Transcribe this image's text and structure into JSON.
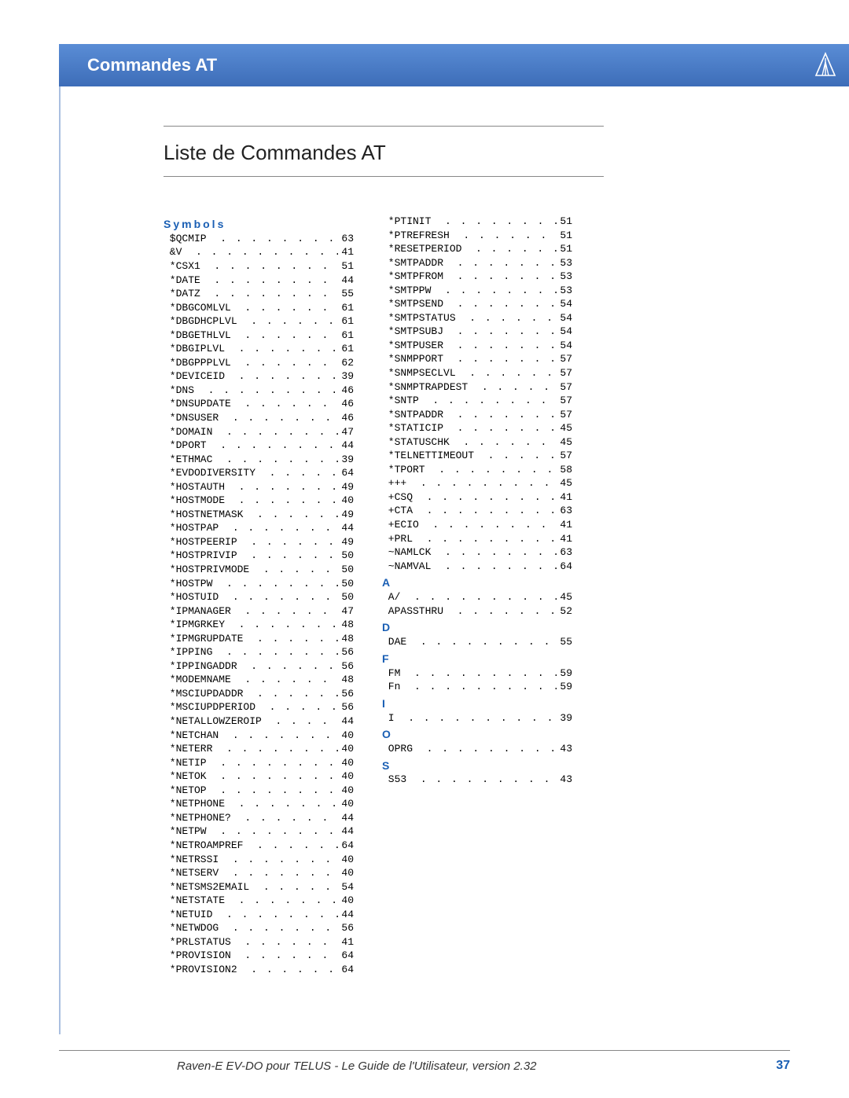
{
  "header": {
    "title": "Commandes AT"
  },
  "section": {
    "title": "Liste de Commandes AT"
  },
  "headings": {
    "symbols": "Symbols",
    "A": "A",
    "D": "D",
    "F": "F",
    "I": "I",
    "O": "O",
    "S": "S"
  },
  "col1": [
    {
      "cmd": "$QCMIP",
      "page": "63"
    },
    {
      "cmd": "&V",
      "page": "41"
    },
    {
      "cmd": "*CSX1",
      "page": "51"
    },
    {
      "cmd": "*DATE",
      "page": "44"
    },
    {
      "cmd": "*DATZ",
      "page": "55"
    },
    {
      "cmd": "*DBGCOMLVL",
      "page": "61"
    },
    {
      "cmd": "*DBGDHCPLVL",
      "page": "61"
    },
    {
      "cmd": "*DBGETHLVL",
      "page": "61"
    },
    {
      "cmd": "*DBGIPLVL",
      "page": "61"
    },
    {
      "cmd": "*DBGPPPLVL",
      "page": "62"
    },
    {
      "cmd": "*DEVICEID",
      "page": "39"
    },
    {
      "cmd": "*DNS",
      "page": "46"
    },
    {
      "cmd": "*DNSUPDATE",
      "page": "46"
    },
    {
      "cmd": "*DNSUSER",
      "page": "46"
    },
    {
      "cmd": "*DOMAIN",
      "page": "47"
    },
    {
      "cmd": "*DPORT",
      "page": "44"
    },
    {
      "cmd": "*ETHMAC",
      "page": "39"
    },
    {
      "cmd": "*EVDODIVERSITY",
      "page": "64"
    },
    {
      "cmd": "*HOSTAUTH",
      "page": "49"
    },
    {
      "cmd": "*HOSTMODE",
      "page": "40"
    },
    {
      "cmd": "*HOSTNETMASK",
      "page": "49"
    },
    {
      "cmd": "*HOSTPAP",
      "page": "44"
    },
    {
      "cmd": "*HOSTPEERIP",
      "page": "49"
    },
    {
      "cmd": "*HOSTPRIVIP",
      "page": "50"
    },
    {
      "cmd": "*HOSTPRIVMODE",
      "page": "50"
    },
    {
      "cmd": "*HOSTPW",
      "page": "50"
    },
    {
      "cmd": "*HOSTUID",
      "page": "50"
    },
    {
      "cmd": "*IPMANAGER",
      "page": "47"
    },
    {
      "cmd": "*IPMGRKEY",
      "page": "48"
    },
    {
      "cmd": "*IPMGRUPDATE",
      "page": "48"
    },
    {
      "cmd": "*IPPING",
      "page": "56"
    },
    {
      "cmd": "*IPPINGADDR",
      "page": "56"
    },
    {
      "cmd": "*MODEMNAME",
      "page": "48"
    },
    {
      "cmd": "*MSCIUPDADDR",
      "page": "56"
    },
    {
      "cmd": "*MSCIUPDPERIOD",
      "page": "56"
    },
    {
      "cmd": "*NETALLOWZEROIP",
      "page": "44"
    },
    {
      "cmd": "*NETCHAN",
      "page": "40"
    },
    {
      "cmd": "*NETERR",
      "page": "40"
    },
    {
      "cmd": "*NETIP",
      "page": "40"
    },
    {
      "cmd": "*NETOK",
      "page": "40"
    },
    {
      "cmd": "*NETOP",
      "page": "40"
    },
    {
      "cmd": "*NETPHONE",
      "page": "40"
    },
    {
      "cmd": "*NETPHONE?",
      "page": "44"
    },
    {
      "cmd": "*NETPW",
      "page": "44"
    },
    {
      "cmd": "*NETROAMPREF",
      "page": "64"
    },
    {
      "cmd": "*NETRSSI",
      "page": "40"
    },
    {
      "cmd": "*NETSERV",
      "page": "40"
    },
    {
      "cmd": "*NETSMS2EMAIL",
      "page": "54"
    },
    {
      "cmd": "*NETSTATE",
      "page": "40"
    },
    {
      "cmd": "*NETUID",
      "page": "44"
    },
    {
      "cmd": "*NETWDOG",
      "page": "56"
    },
    {
      "cmd": "*PRLSTATUS",
      "page": "41"
    },
    {
      "cmd": "*PROVISION",
      "page": "64"
    },
    {
      "cmd": "*PROVISION2",
      "page": "64"
    }
  ],
  "col2a": [
    {
      "cmd": "*PTINIT",
      "page": "51"
    },
    {
      "cmd": "*PTREFRESH",
      "page": "51"
    },
    {
      "cmd": "*RESETPERIOD",
      "page": "51"
    },
    {
      "cmd": "*SMTPADDR",
      "page": "53"
    },
    {
      "cmd": "*SMTPFROM",
      "page": "53"
    },
    {
      "cmd": "*SMTPPW",
      "page": "53"
    },
    {
      "cmd": "*SMTPSEND",
      "page": "54"
    },
    {
      "cmd": "*SMTPSTATUS",
      "page": "54"
    },
    {
      "cmd": "*SMTPSUBJ",
      "page": "54"
    },
    {
      "cmd": "*SMTPUSER",
      "page": "54"
    },
    {
      "cmd": "*SNMPPORT",
      "page": "57"
    },
    {
      "cmd": "*SNMPSECLVL",
      "page": "57"
    },
    {
      "cmd": "*SNMPTRAPDEST",
      "page": "57"
    },
    {
      "cmd": "*SNTP",
      "page": "57"
    },
    {
      "cmd": "*SNTPADDR",
      "page": "57"
    },
    {
      "cmd": "*STATICIP",
      "page": "45"
    },
    {
      "cmd": "*STATUSCHK",
      "page": "45"
    },
    {
      "cmd": "*TELNETTIMEOUT",
      "page": "57"
    },
    {
      "cmd": "*TPORT",
      "page": "58"
    },
    {
      "cmd": "+++",
      "page": "45"
    },
    {
      "cmd": "+CSQ",
      "page": "41"
    },
    {
      "cmd": "+CTA",
      "page": "63"
    },
    {
      "cmd": "+ECIO",
      "page": "41"
    },
    {
      "cmd": "+PRL",
      "page": "41"
    },
    {
      "cmd": "~NAMLCK",
      "page": "63"
    },
    {
      "cmd": "~NAMVAL",
      "page": "64"
    }
  ],
  "secA": [
    {
      "cmd": "A/",
      "page": "45"
    },
    {
      "cmd": "APASSTHRU",
      "page": "52"
    }
  ],
  "secD": [
    {
      "cmd": "DAE",
      "page": "55"
    }
  ],
  "secF": [
    {
      "cmd": "FM",
      "page": "59"
    },
    {
      "cmd": "Fn",
      "page": "59"
    }
  ],
  "secI": [
    {
      "cmd": "I",
      "page": "39"
    }
  ],
  "secO": [
    {
      "cmd": "OPRG",
      "page": "43"
    }
  ],
  "secS": [
    {
      "cmd": "S53",
      "page": "43"
    }
  ],
  "footer": {
    "text": "Raven-E EV-DO pour TELUS - Le Guide de l'Utilisateur, version 2.32",
    "page": "37"
  }
}
